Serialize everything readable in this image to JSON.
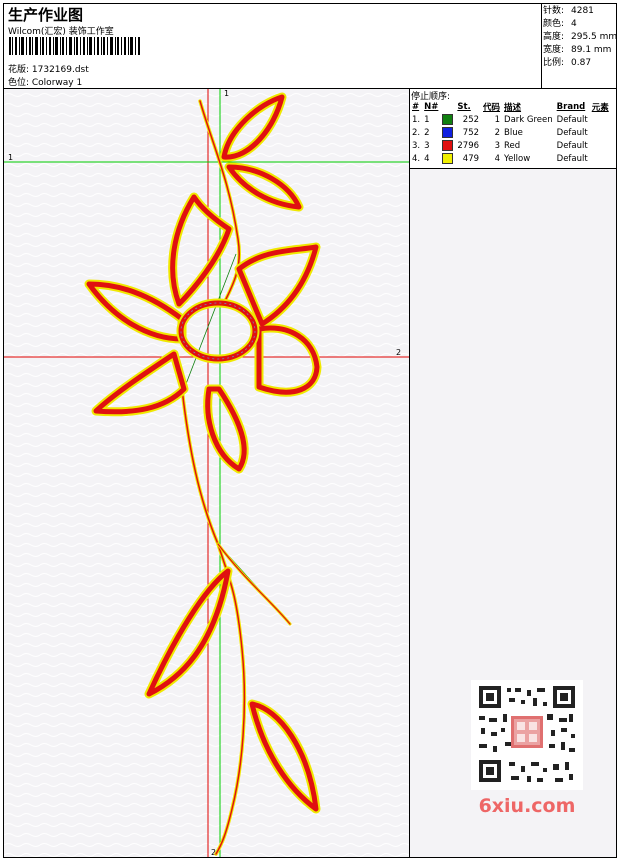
{
  "header": {
    "title": "生产作业图",
    "company": "Wilcom(汇宏) 装饰工作室",
    "design_label": "花版: 1732169.dst",
    "colorway_label": "色位: Colorway 1"
  },
  "stats": [
    {
      "label": "针数:",
      "value": "4281"
    },
    {
      "label": "颜色:",
      "value": "4"
    },
    {
      "label": "高度:",
      "value": "295.5 mm"
    },
    {
      "label": "宽度:",
      "value": "89.1 mm"
    },
    {
      "label": "比例:",
      "value": "0.87"
    }
  ],
  "stop_sequence": {
    "title": "停止顺序:",
    "headers": [
      "#",
      "N#",
      "St.",
      "代码",
      "描述",
      "Brand",
      "元素"
    ],
    "rows": [
      {
        "idx": "1.",
        "n": "1",
        "st": "252",
        "code": "1",
        "desc": "Dark Green",
        "brand": "Default",
        "color": "#108010"
      },
      {
        "idx": "2.",
        "n": "2",
        "st": "752",
        "code": "2",
        "desc": "Blue",
        "brand": "Default",
        "color": "#1020e0"
      },
      {
        "idx": "3.",
        "n": "3",
        "st": "2796",
        "code": "3",
        "desc": "Red",
        "brand": "Default",
        "color": "#e01010"
      },
      {
        "idx": "4.",
        "n": "4",
        "st": "479",
        "code": "4",
        "desc": "Yellow",
        "brand": "Default",
        "color": "#f0f000"
      }
    ]
  },
  "guides": {
    "markers": [
      "1",
      "1",
      "2",
      "2"
    ]
  },
  "watermark": {
    "site": "6xiu.com"
  },
  "colors": {
    "guide_green": "#00cc00",
    "guide_red": "#e00000",
    "stitch_red": "#e01010",
    "stitch_yellow": "#f0e800",
    "stitch_green": "#108010"
  }
}
